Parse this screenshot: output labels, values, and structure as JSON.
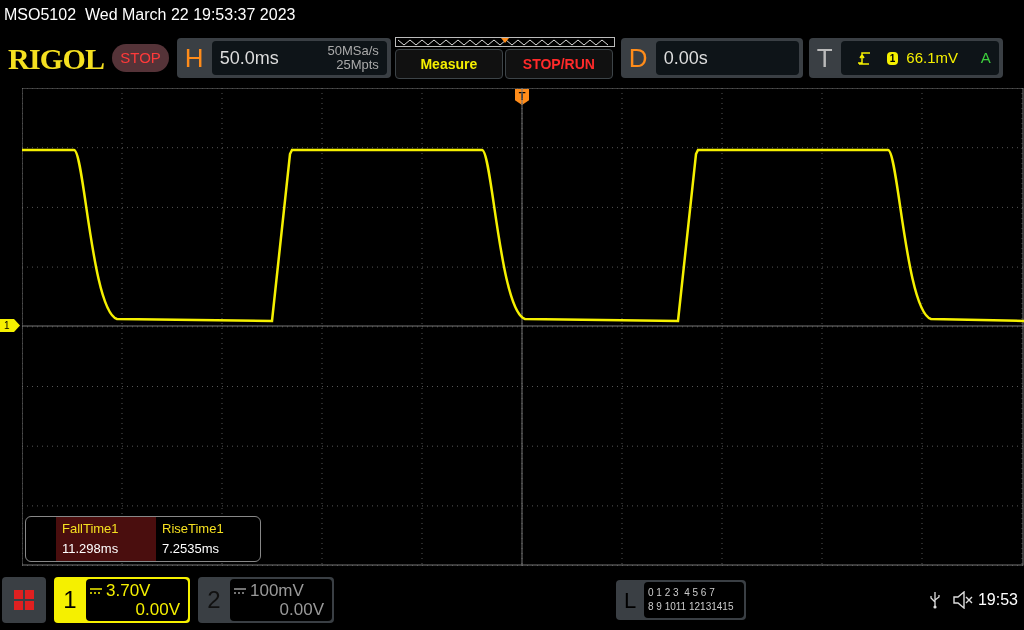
{
  "title_bar": {
    "text": "MSO5102  Wed March 22 19:53:37 2023"
  },
  "logo": "RIGOL",
  "run_state": {
    "label": "STOP",
    "running": false
  },
  "horizontal": {
    "label": "H",
    "timebase": "50.0ms",
    "sample_rate": "50MSa/s",
    "memory_depth": "25Mpts"
  },
  "buttons": [
    {
      "label": "Measure",
      "kind": "measure"
    },
    {
      "label": "STOP/RUN",
      "kind": "run"
    }
  ],
  "delay": {
    "label": "D",
    "value": "0.00s"
  },
  "trigger": {
    "label": "T",
    "source": "1",
    "level": "66.1mV",
    "mode": "A"
  },
  "trigger_position_marker": "T",
  "channel_marker": "1",
  "measurements": [
    {
      "name": "FallTime1",
      "value": "11.298ms",
      "selected": true
    },
    {
      "name": "RiseTime1",
      "value": "7.2535ms",
      "selected": false
    }
  ],
  "channels": [
    {
      "number": "1",
      "scale": "3.70V",
      "offset": "0.00V",
      "on": true
    },
    {
      "number": "2",
      "scale": "100mV",
      "offset": "0.00V",
      "on": false
    }
  ],
  "logic": {
    "label": "L",
    "rows": [
      "0 1 2 3  4 5 6 7",
      "8 9 1011 12131415"
    ]
  },
  "clock": "19:53"
}
